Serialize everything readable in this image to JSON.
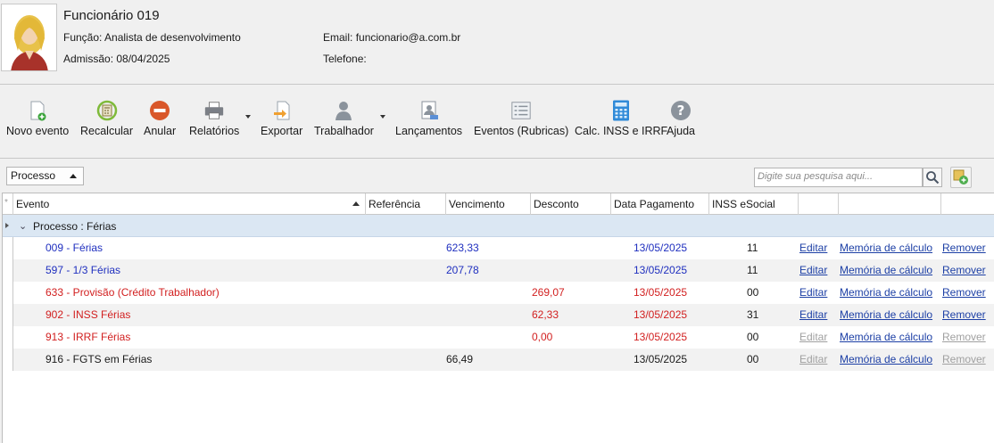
{
  "employee": {
    "name": "Funcionário 019",
    "funcao_label": "Função:",
    "funcao": "Analista de desenvolvimento",
    "admissao_label": "Admissão:",
    "admissao": "08/04/2025",
    "email_label": "Email:",
    "email": "funcionario@a.com.br",
    "telefone_label": "Telefone:",
    "telefone": ""
  },
  "toolbar": {
    "novo_evento": "Novo evento",
    "recalcular": "Recalcular",
    "anular": "Anular",
    "relatorios": "Relatórios",
    "exportar": "Exportar",
    "trabalhador": "Trabalhador",
    "lancamentos": "Lançamentos",
    "eventos_rubricas": "Eventos (Rubricas)",
    "calc_inss_irrf": "Calc. INSS e IRRF",
    "ajuda": "Ajuda"
  },
  "filter": {
    "select_value": "Processo",
    "search_placeholder": "Digite sua pesquisa aqui..."
  },
  "grid": {
    "columns": [
      "Evento",
      "Referência",
      "Vencimento",
      "Desconto",
      "Data Pagamento",
      "INSS eSocial"
    ],
    "group_label": "Processo : Férias",
    "action_labels": {
      "edit": "Editar",
      "memory": "Memória de cálculo",
      "remove": "Remover"
    },
    "rows": [
      {
        "evento": "009 - Férias",
        "referencia": "",
        "vencimento": "623,33",
        "desconto": "",
        "data": "13/05/2025",
        "inss": "11",
        "color": "#1f2fbf"
      },
      {
        "evento": "597 - 1/3 Férias",
        "referencia": "",
        "vencimento": "207,78",
        "desconto": "",
        "data": "13/05/2025",
        "inss": "11",
        "color": "#1f2fbf"
      },
      {
        "evento": "633 - Provisão (Crédito Trabalhador)",
        "referencia": "",
        "vencimento": "",
        "desconto": "269,07",
        "data": "13/05/2025",
        "inss": "00",
        "color": "#d22020"
      },
      {
        "evento": "902 - INSS Férias",
        "referencia": "",
        "vencimento": "",
        "desconto": "62,33",
        "data": "13/05/2025",
        "inss": "31",
        "color": "#d22020"
      },
      {
        "evento": "913 - IRRF Férias",
        "referencia": "",
        "vencimento": "",
        "desconto": "0,00",
        "data": "13/05/2025",
        "inss": "00",
        "color": "#d22020"
      },
      {
        "evento": "916 - FGTS em Férias",
        "referencia": "",
        "vencimento": "66,49",
        "desconto": "",
        "data": "13/05/2025",
        "inss": "00",
        "color": "#1a1a1a"
      }
    ]
  }
}
